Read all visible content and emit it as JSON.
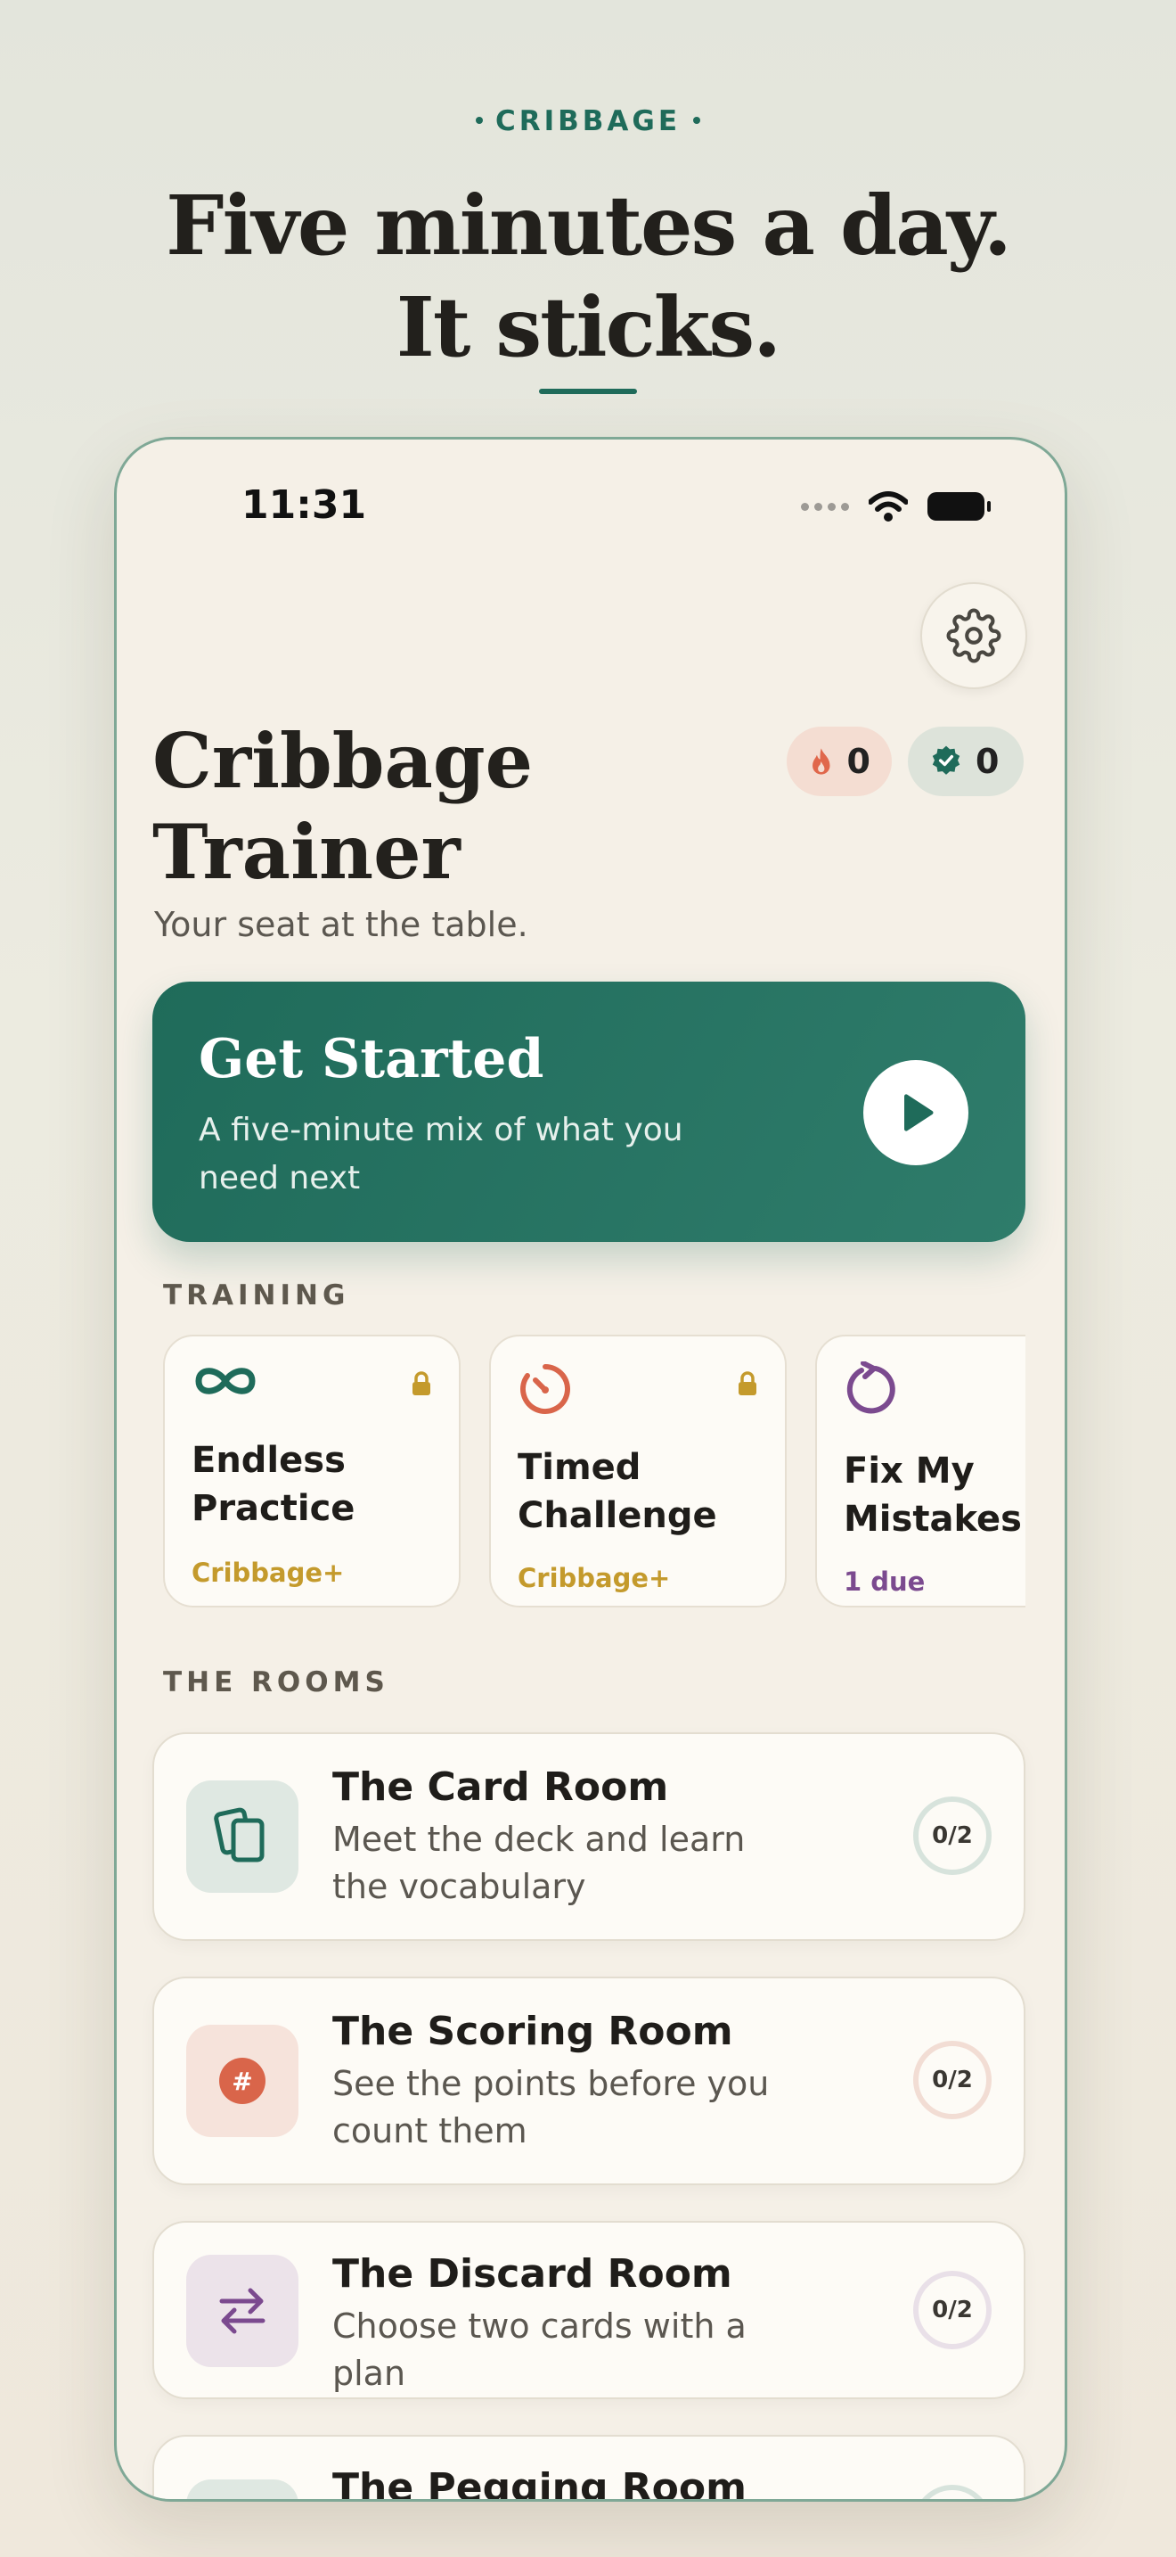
{
  "marketing": {
    "eyebrow": "CRIBBAGE",
    "headline": "Five minutes a day. It sticks."
  },
  "status_bar": {
    "time": "11:31"
  },
  "header": {
    "title": "Cribbage Trainer",
    "subtitle": "Your seat at the table.",
    "streak_count": "0",
    "badge_count": "0"
  },
  "hero": {
    "title": "Get Started",
    "description": "A five-minute mix of what you need next"
  },
  "training": {
    "label": "TRAINING",
    "cards": [
      {
        "name": "Endless Practice",
        "sub": "Cribbage+",
        "icon": "infinity-icon",
        "locked": true
      },
      {
        "name": "Timed Challenge",
        "sub": "Cribbage+",
        "icon": "timer-icon",
        "locked": true
      },
      {
        "name": "Fix My Mistakes",
        "sub": "1 due",
        "icon": "retry-icon",
        "locked": false
      }
    ]
  },
  "rooms": {
    "label": "THE ROOMS",
    "items": [
      {
        "name": "The Card Room",
        "description": "Meet the deck and learn the vocabulary",
        "progress": "0/2",
        "icon": "cards-icon"
      },
      {
        "name": "The Scoring Room",
        "description": "See the points before you count them",
        "progress": "0/2",
        "icon": "hash-icon"
      },
      {
        "name": "The Discard Room",
        "description": "Choose two cards with a plan",
        "progress": "0/2",
        "icon": "swap-arrows-icon"
      },
      {
        "name": "The Pegging Room",
        "description": "",
        "progress": "",
        "icon": "pegging-icon"
      }
    ]
  },
  "colors": {
    "accent": "#1f6b5a",
    "gold": "#c49a2c",
    "purple": "#7b4a8f",
    "coral": "#d9654a",
    "background": "#f5f0e7"
  }
}
